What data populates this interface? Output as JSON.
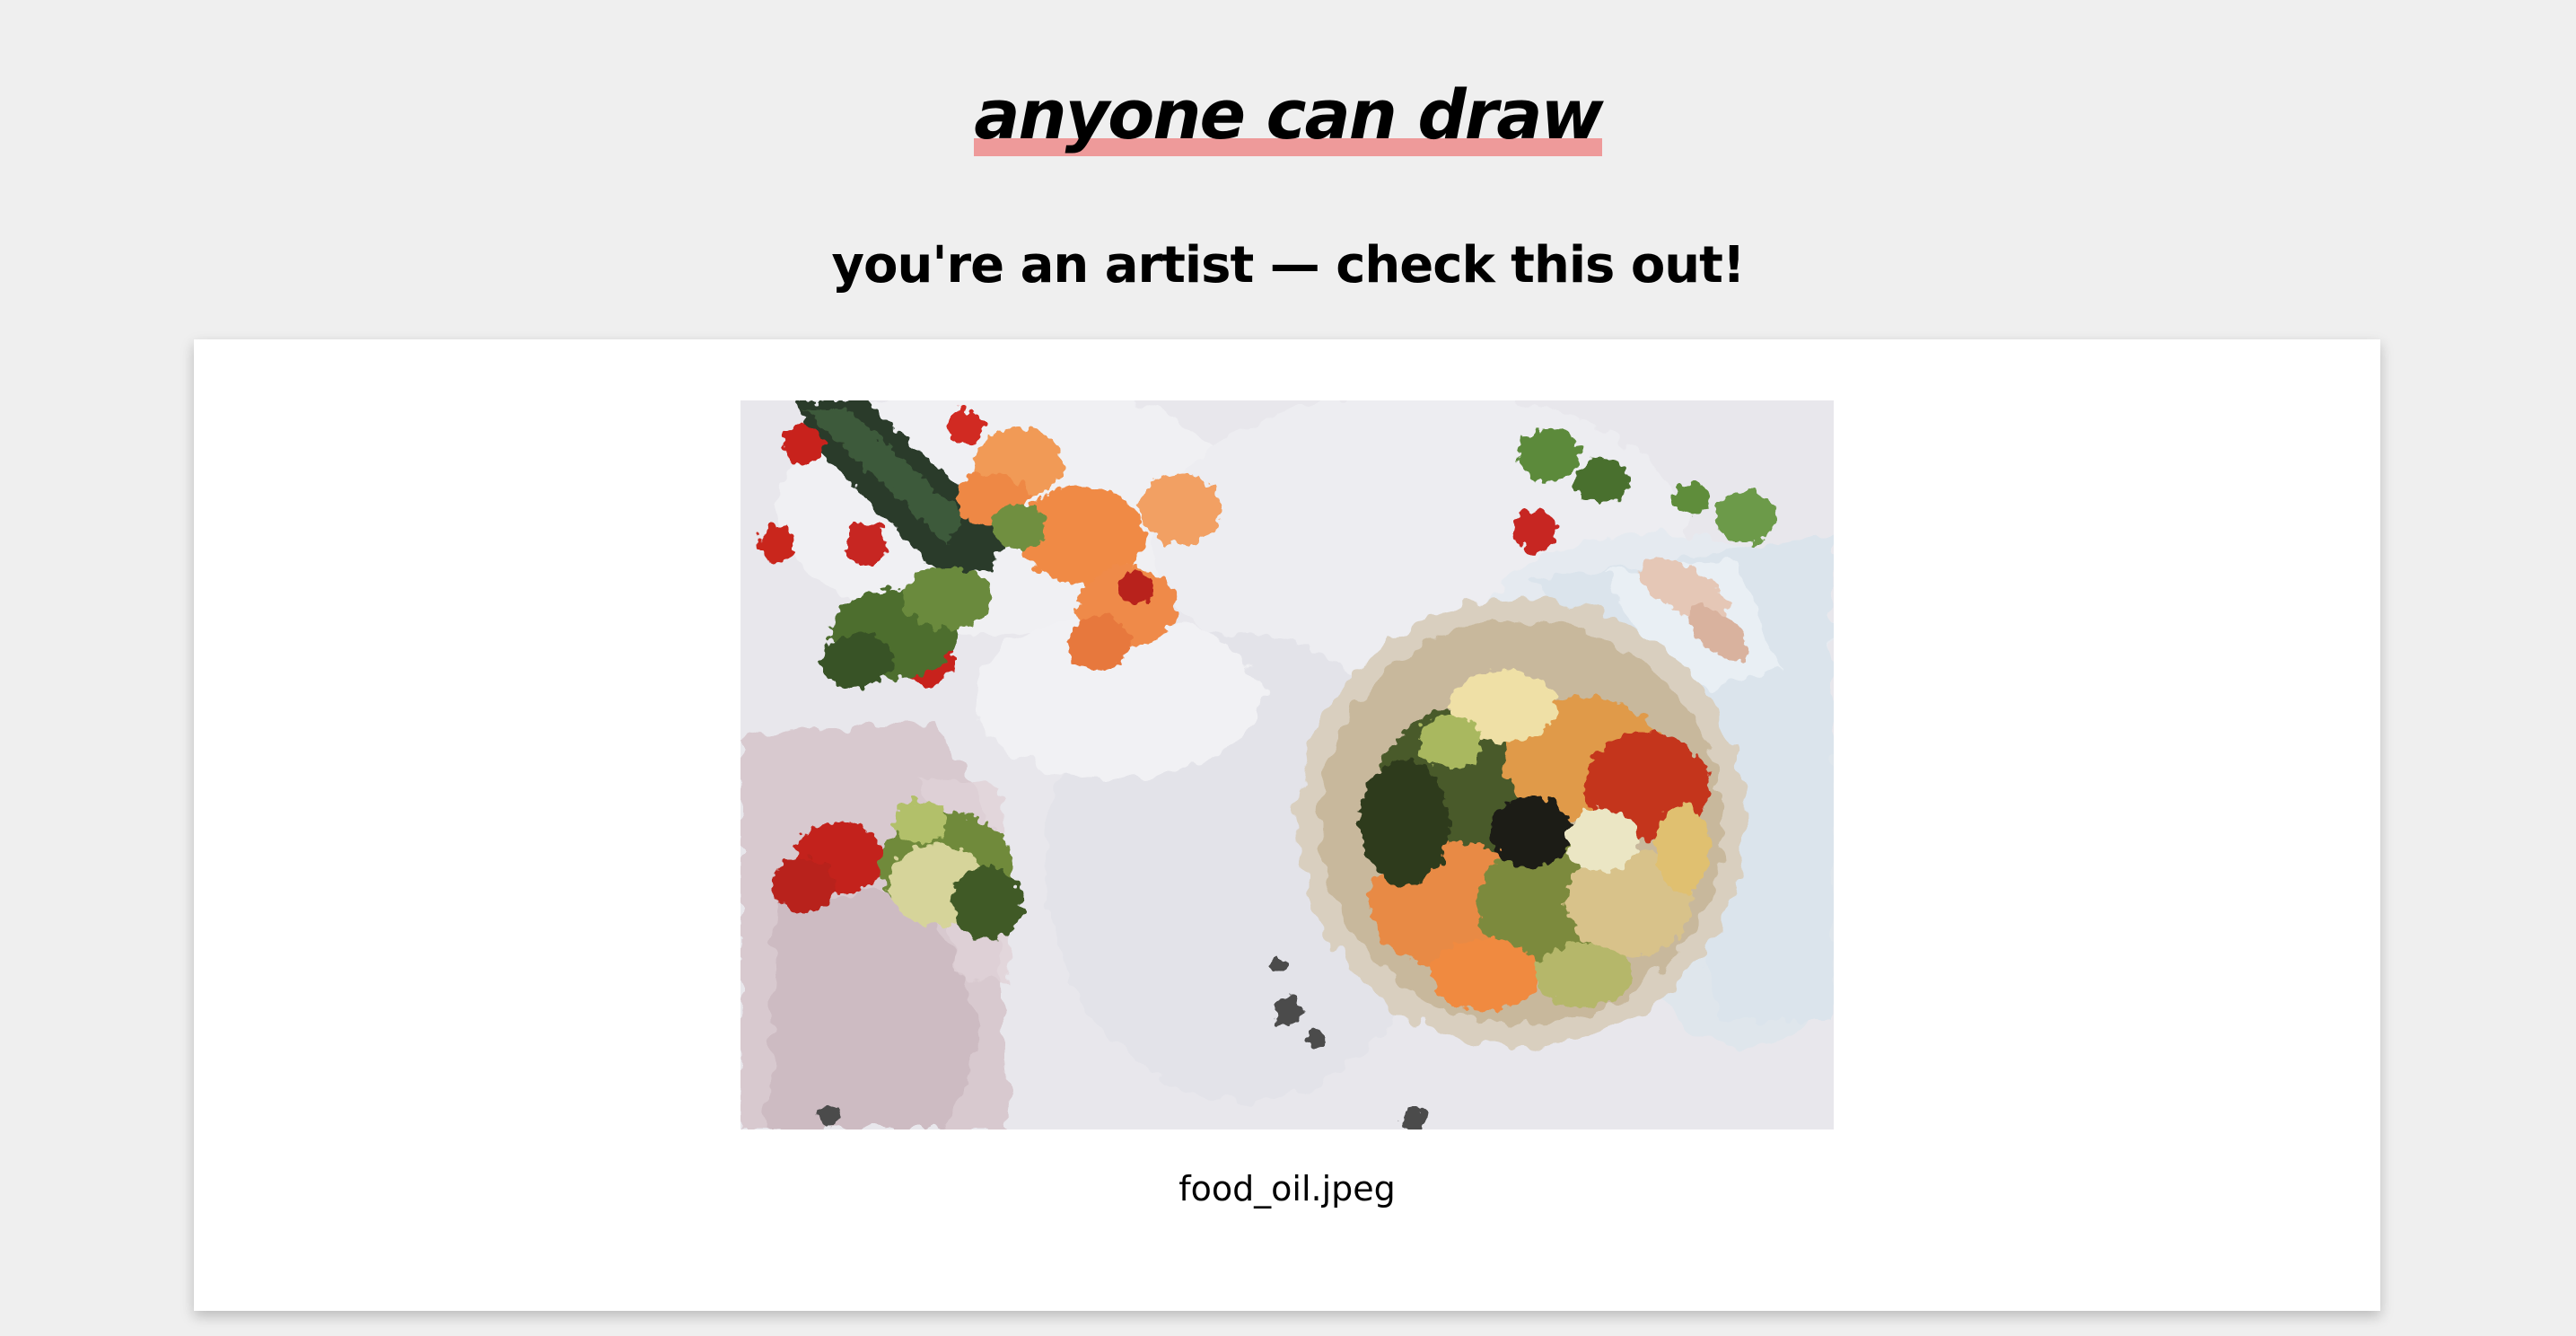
{
  "header": {
    "title": "anyone can draw",
    "subtitle": "you're an artist — check this out!"
  },
  "result": {
    "image_alt": "food_oil.jpeg",
    "filename": "food_oil.jpeg"
  },
  "colors": {
    "background": "#efefef",
    "card": "#ffffff",
    "title_underline": "#ee9a9a"
  }
}
